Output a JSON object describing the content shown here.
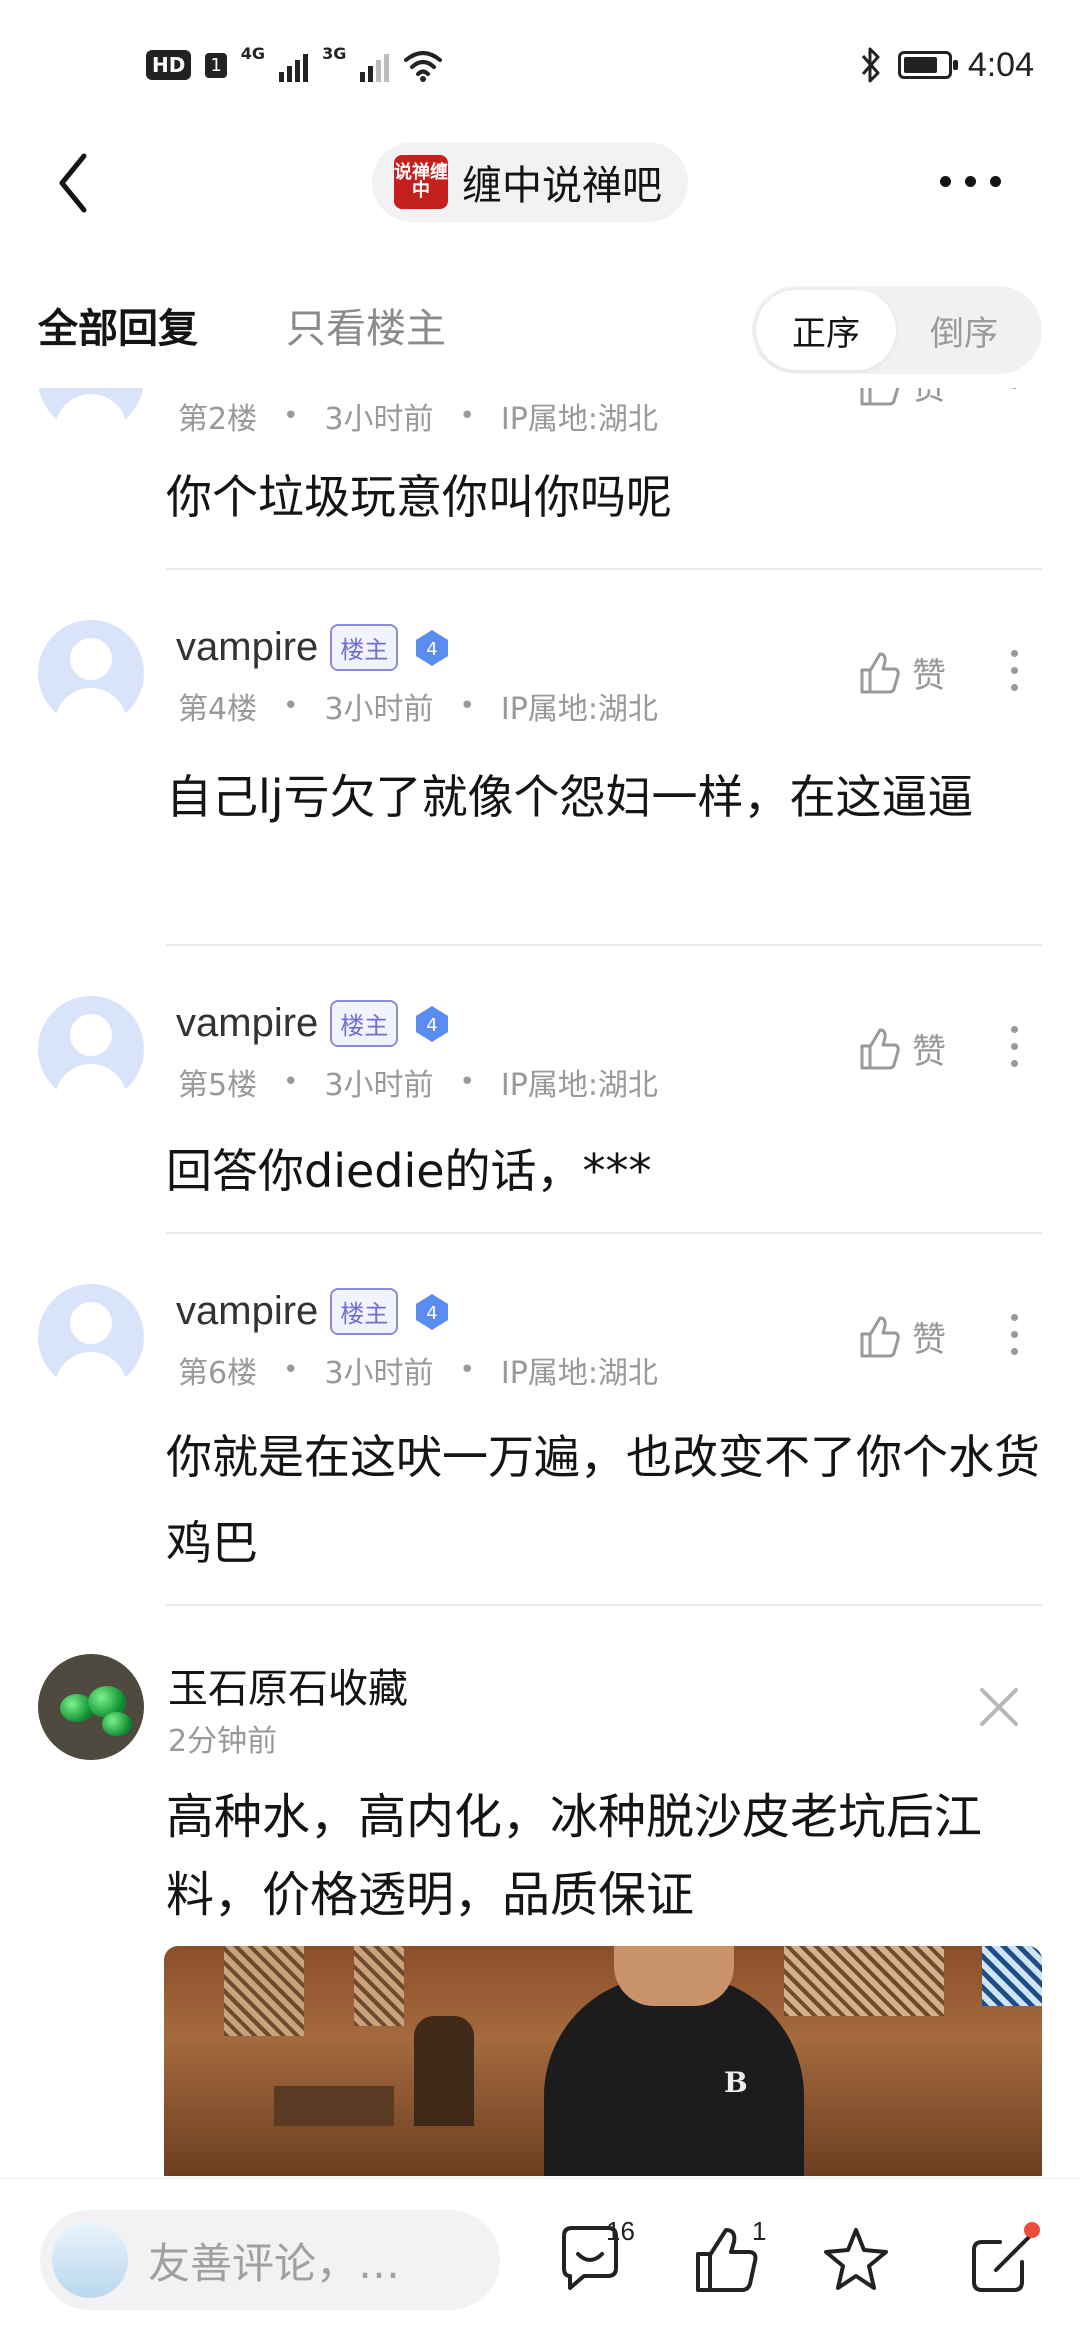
{
  "status_bar": {
    "hd": "HD",
    "sim": "1",
    "net1": "4G",
    "net2": "3G",
    "time": "4:04"
  },
  "header": {
    "logo_text": "说禅缠中",
    "title": "缠中说禅吧"
  },
  "tabs": {
    "all": "全部回复",
    "op_only": "只看楼主",
    "sort_asc": "正序",
    "sort_desc": "倒序"
  },
  "posts": [
    {
      "floor": "第2楼",
      "time": "3小时前",
      "ip": "IP属地:湖北",
      "like_label": "赞",
      "content": "你个垃圾玩意你叫你吗呢"
    },
    {
      "username": "vampire",
      "op_badge": "楼主",
      "level": "4",
      "floor": "第4楼",
      "time": "3小时前",
      "ip": "IP属地:湖北",
      "like_label": "赞",
      "content": "自己lj亏欠了就像个怨妇一样，在这逼逼"
    },
    {
      "username": "vampire",
      "op_badge": "楼主",
      "level": "4",
      "floor": "第5楼",
      "time": "3小时前",
      "ip": "IP属地:湖北",
      "like_label": "赞",
      "content": "回答你diedie的话，***"
    },
    {
      "username": "vampire",
      "op_badge": "楼主",
      "level": "4",
      "floor": "第6楼",
      "time": "3小时前",
      "ip": "IP属地:湖北",
      "like_label": "赞",
      "content": "你就是在这吠一万遍，也改变不了你个水货鸡巴"
    }
  ],
  "ad": {
    "name": "玉石原石收藏",
    "time": "2分钟前",
    "text": "高种水，高内化，冰种脱沙皮老坑后江料，价格透明，品质保证",
    "shirt_logo": "B"
  },
  "bottom_bar": {
    "placeholder": "友善评论，…",
    "comment_count": "16",
    "like_count": "1"
  },
  "colors": {
    "op_badge": "#6f6fd6",
    "level_badge": "#5b8cf0",
    "notify_dot": "#f04a3a"
  }
}
